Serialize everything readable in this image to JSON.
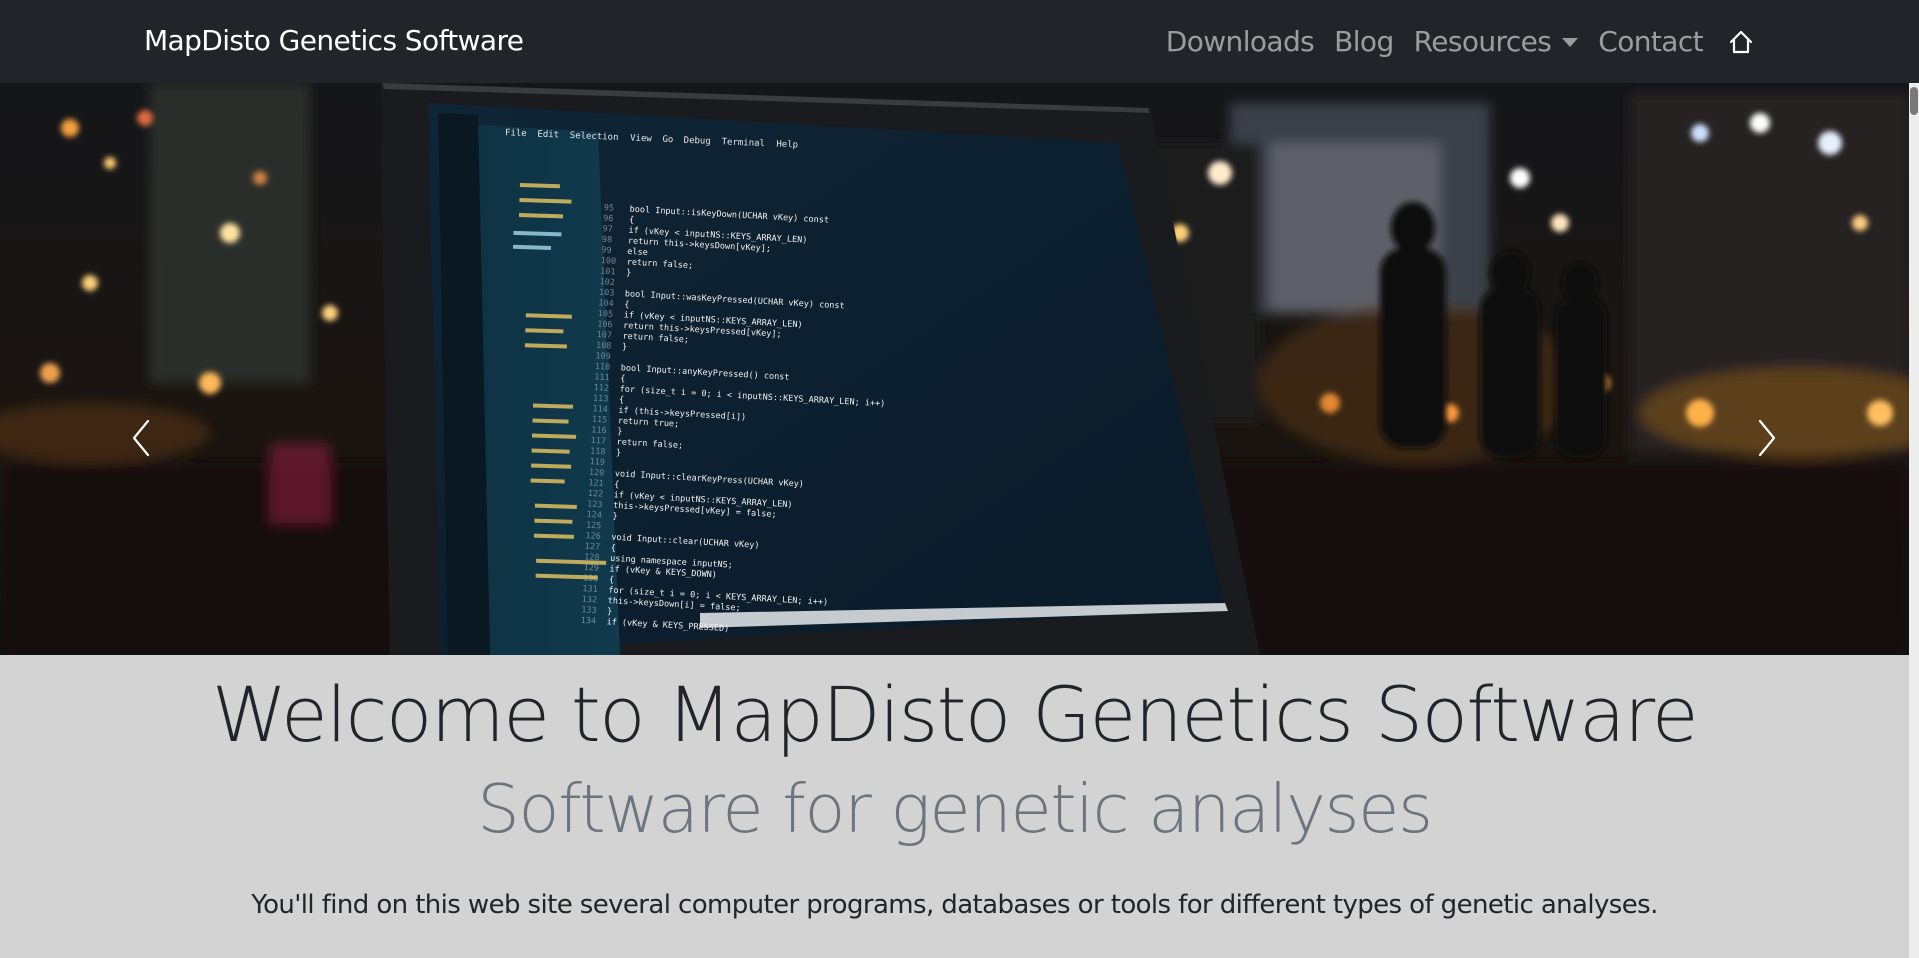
{
  "navbar": {
    "brand": "MapDisto Genetics Software",
    "links": {
      "downloads": "Downloads",
      "blog": "Blog",
      "resources": "Resources",
      "contact": "Contact"
    }
  },
  "hero": {
    "code_editor_menu": [
      "File",
      "Edit",
      "Selection",
      "View",
      "Go",
      "Debug",
      "Terminal",
      "Help"
    ],
    "code_lines": [
      "bool Input::isKeyDown(UCHAR vKey) const",
      "{",
      "    if (vKey < inputNS::KEYS_ARRAY_LEN)",
      "        return this->keysDown[vKey];",
      "    else",
      "        return false;",
      "}",
      "",
      "bool Input::wasKeyPressed(UCHAR vKey) const",
      "{",
      "    if (vKey < inputNS::KEYS_ARRAY_LEN)",
      "        return this->keysPressed[vKey];",
      "    return false;",
      "}",
      "",
      "bool Input::anyKeyPressed() const",
      "{",
      "    for (size_t i = 0; i < inputNS::KEYS_ARRAY_LEN; i++)",
      "    {",
      "        if (this->keysPressed[i])",
      "            return true;",
      "    }",
      "    return false;",
      "}",
      "",
      "void Input::clearKeyPress(UCHAR vKey)",
      "{",
      "    if (vKey < inputNS::KEYS_ARRAY_LEN)",
      "        this->keysPressed[vKey] = false;",
      "}",
      "",
      "void Input::clear(UCHAR vKey)",
      "{",
      "    using namespace inputNS;",
      "    if (vKey & KEYS_DOWN)",
      "    {",
      "        for (size_t i = 0; i < KEYS_ARRAY_LEN; i++)",
      "            this->keysDown[i] = false;",
      "    }",
      "    if (vKey & KEYS_PRESSED)"
    ],
    "code_first_line_number": 95
  },
  "content": {
    "title": "Welcome to MapDisto Genetics Software",
    "subtitle": "Software for genetic analyses",
    "lead": "You'll find on this web site several computer programs, databases or tools for different types of genetic analyses."
  },
  "colors": {
    "navbar_bg": "#212529",
    "page_bg": "#d3d3d3",
    "title": "#212529",
    "subtitle": "#6c757d"
  },
  "icons": {
    "home": "home-icon",
    "prev": "chevron-left-icon",
    "next": "chevron-right-icon",
    "dropdown": "caret-down-icon"
  }
}
